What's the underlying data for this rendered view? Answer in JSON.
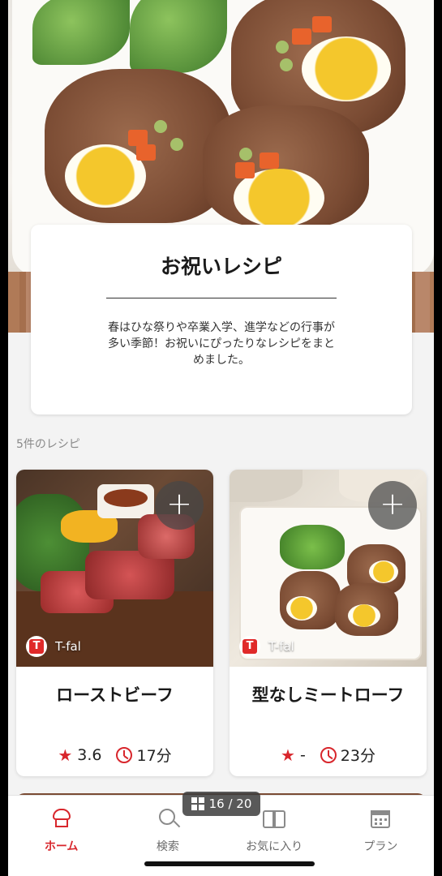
{
  "intro": {
    "title": "お祝いレシピ",
    "description": "春はひな祭りや卒業入学、進学などの行事が多い季節！お祝いにぴったりなレシピをまとめました。"
  },
  "results": {
    "count_label": "5件のレシピ"
  },
  "recipes": [
    {
      "name": "ローストビーフ",
      "brand": "T-fal",
      "brand_initial": "T",
      "rating": "3.6",
      "time": "17分",
      "add_symbol": "+"
    },
    {
      "name": "型なしミートローフ",
      "brand": "T-fal",
      "brand_initial": "T",
      "rating": "-",
      "time": "23分",
      "add_symbol": "+"
    }
  ],
  "icons": {
    "star": "★"
  },
  "tabbar": {
    "items": [
      {
        "label": "ホーム",
        "icon": "chef-hat-icon",
        "active": true
      },
      {
        "label": "検索",
        "icon": "search-icon",
        "active": false
      },
      {
        "label": "お気に入り",
        "icon": "book-icon",
        "active": false
      },
      {
        "label": "プラン",
        "icon": "calendar-icon",
        "active": false
      }
    ]
  },
  "overlay": {
    "page_counter": "16 / 20"
  },
  "colors": {
    "accent": "#d8262c",
    "brand": "#e02a2a"
  }
}
